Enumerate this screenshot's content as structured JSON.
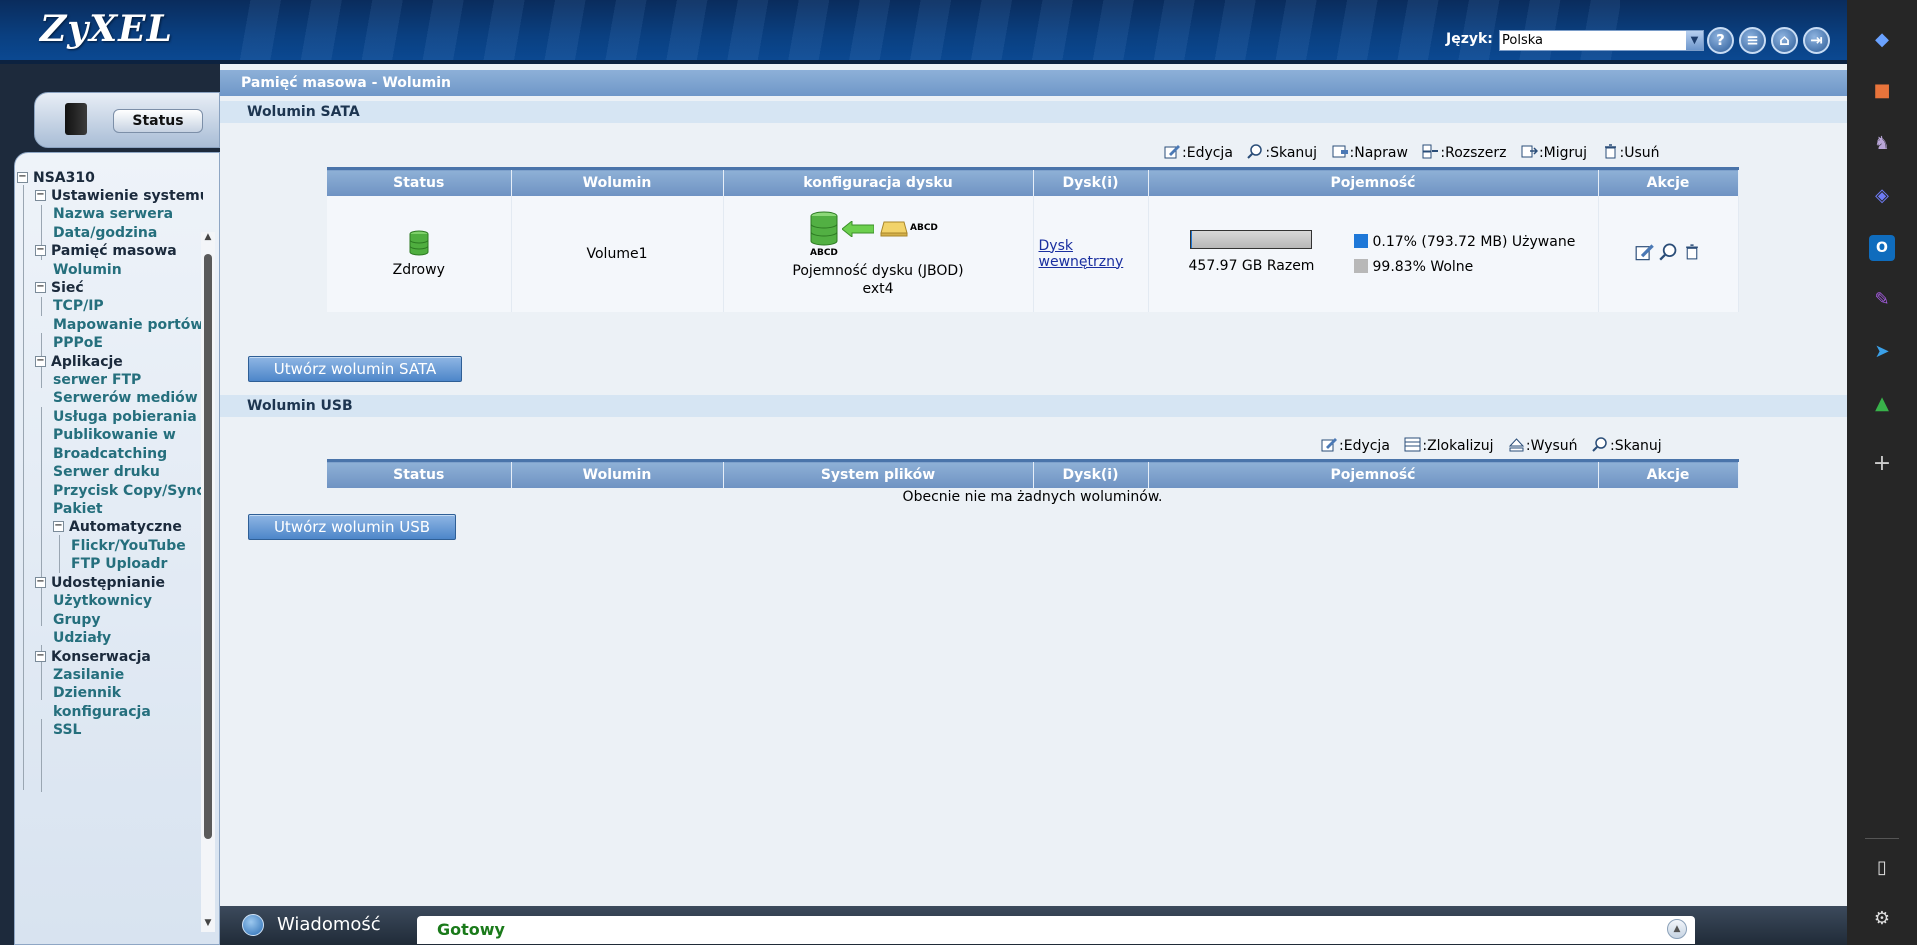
{
  "header": {
    "logo": "ZyXEL",
    "lang_label": "Język:",
    "lang_value": "Polska",
    "buttons": [
      "help-icon",
      "notes-icon",
      "home-icon",
      "logout-icon"
    ]
  },
  "sidebar": {
    "status_tab": "Status",
    "tree": {
      "root": "NSA310",
      "ustawienie": "Ustawienie systemu",
      "nazwa": "Nazwa serwera",
      "data": "Data/godzina",
      "pamiec": "Pamięć masowa",
      "wolumin": "Wolumin",
      "siec": "Sieć",
      "tcpip": "TCP/IP",
      "mapowanie": "Mapowanie portów",
      "pppoe": "PPPoE",
      "aplikacje": "Aplikacje",
      "ftp": "serwer FTP",
      "media": "Serwerów mediów",
      "pobieranie": "Usługa pobierania",
      "publikowanie": "Publikowanie w",
      "broadcatching": "Broadcatching",
      "druk": "Serwer druku",
      "przycisk": "Przycisk Copy/Sync",
      "pakiet": "Pakiet",
      "automatyczne": "Automatyczne",
      "flickr": "Flickr/YouTube",
      "ftpupload": "FTP Uploadr",
      "udostepnianie": "Udostępnianie",
      "uzytkownicy": "Użytkownicy",
      "grupy": "Grupy",
      "udzialy": "Udziały",
      "konserwacja": "Konserwacja",
      "zasilanie": "Zasilanie",
      "dziennik": "Dziennik",
      "konfiguracja": "konfiguracja",
      "ssl": "SSL"
    }
  },
  "main": {
    "page_title": "Pamięć masowa - Wolumin",
    "sata": {
      "title": "Wolumin SATA",
      "legend": {
        "edit": ":Edycja",
        "scan": ":Skanuj",
        "repair": ":Napraw",
        "expand": ":Rozszerz",
        "migrate": ":Migruj",
        "delete": ":Usuń"
      },
      "columns": [
        "Status",
        "Wolumin",
        "konfiguracja dysku",
        "Dysk(i)",
        "Pojemność",
        "Akcje"
      ],
      "row": {
        "status": "Zdrowy",
        "volume": "Volume1",
        "disk_label_a": "ABCD",
        "disk_label_b": "ABCD",
        "config_line1": "Pojemność dysku (JBOD)",
        "config_line2": "ext4",
        "disk_link": "Dysk wewnętrzny",
        "total": "457.97 GB Razem",
        "used": "0.17% (793.72 MB) Używane",
        "free": "99.83% Wolne",
        "used_fraction": 0.0017
      },
      "create_button": "Utwórz wolumin SATA"
    },
    "usb": {
      "title": "Wolumin USB",
      "legend": {
        "edit": ":Edycja",
        "locate": ":Zlokalizuj",
        "eject": ":Wysuń",
        "scan": ":Skanuj"
      },
      "columns": [
        "Status",
        "Wolumin",
        "System plików",
        "Dysk(i)",
        "Pojemność",
        "Akcje"
      ],
      "empty": "Obecnie nie ma żadnych woluminów.",
      "create_button": "Utwórz wolumin USB"
    }
  },
  "message_bar": {
    "label": "Wiadomość",
    "text": "Gotowy"
  },
  "colors": {
    "header": "#0b4a94",
    "table_header": "#7a9cc8",
    "used": "#1e78d8",
    "free": "#b8b8b8",
    "status_ok": "#1a7a1a"
  }
}
